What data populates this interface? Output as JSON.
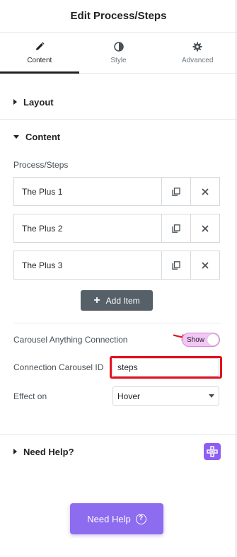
{
  "panel": {
    "title": "Edit Process/Steps"
  },
  "tabs": [
    {
      "label": "Content",
      "icon": "pencil-icon",
      "active": true
    },
    {
      "label": "Style",
      "icon": "contrast-icon",
      "active": false
    },
    {
      "label": "Advanced",
      "icon": "gear-icon",
      "active": false
    }
  ],
  "sections": {
    "layout": {
      "title": "Layout",
      "expanded": false
    },
    "content": {
      "title": "Content",
      "expanded": true
    },
    "help": {
      "title": "Need Help?",
      "expanded": false
    }
  },
  "repeater": {
    "label": "Process/Steps",
    "items": [
      {
        "title": "The Plus 1"
      },
      {
        "title": "The Plus 2"
      },
      {
        "title": "The Plus 3"
      }
    ],
    "add_label": "Add Item"
  },
  "controls": {
    "carousel_connection": {
      "label": "Carousel Anything Connection",
      "toggle_text": "Show",
      "enabled": true
    },
    "carousel_id": {
      "label": "Connection Carousel ID",
      "value": "steps"
    },
    "effect_on": {
      "label": "Effect on",
      "value": "Hover"
    }
  },
  "help_button": {
    "label": "Need Help",
    "icon_glyph": "?"
  },
  "colors": {
    "accent_purple": "#8e6cf0",
    "toggle_pink": "#f3c6f5",
    "annotation_red": "#e3121f",
    "add_button": "#556068"
  }
}
